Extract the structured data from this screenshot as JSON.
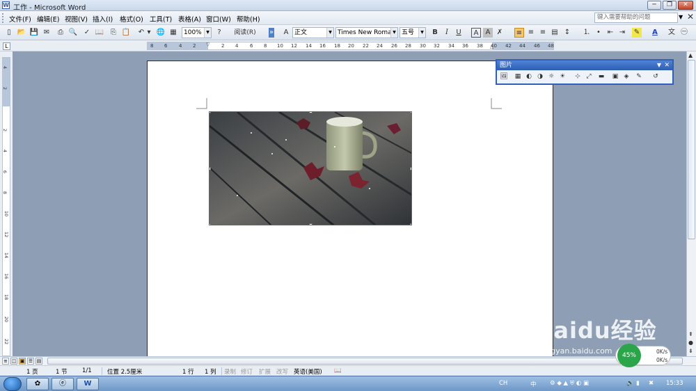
{
  "window": {
    "title": "工作 - Microsoft Word",
    "controls": [
      "─",
      "❐",
      "✕"
    ]
  },
  "menu": {
    "items": [
      "文件(F)",
      "编辑(E)",
      "视图(V)",
      "插入(I)",
      "格式(O)",
      "工具(T)",
      "表格(A)",
      "窗口(W)",
      "帮助(H)"
    ],
    "help_placeholder": "键入需要帮助的问题"
  },
  "toolbar": {
    "zoom": "100%",
    "read_button": "阅读(R)",
    "style": "正文",
    "font": "Times New Roman",
    "font_size": "五号",
    "bold": "B",
    "italic": "I",
    "underline": "U",
    "char_border": "A",
    "char_shading": "A",
    "font_color": "A"
  },
  "ruler": {
    "tab_selector": "L",
    "h_labels": [
      "8",
      "6",
      "4",
      "2",
      "2",
      "4",
      "6",
      "8",
      "10",
      "12",
      "14",
      "16",
      "18",
      "20",
      "22",
      "24",
      "26",
      "28",
      "30",
      "32",
      "34",
      "36",
      "38",
      "40",
      "42",
      "44",
      "46",
      "48"
    ],
    "v_labels": [
      "4",
      "2",
      "2",
      "4",
      "6",
      "8",
      "10",
      "12",
      "14",
      "16",
      "18",
      "20",
      "22"
    ]
  },
  "picture_toolbar": {
    "title": "图片",
    "tools": [
      "🖼",
      "▦",
      "◐",
      "◑",
      "☼",
      "☀",
      "⊹",
      "⤢",
      "▬",
      "▣",
      "◈",
      "✎",
      "↺"
    ]
  },
  "status": {
    "page": "1 页",
    "section": "1 节",
    "page_of": "1/1",
    "position": "位置 2.5厘米",
    "line": "1 行",
    "column": "1 列",
    "rec": "录制",
    "track": "修订",
    "ext": "扩展",
    "ovr": "改写",
    "language": "英语(美国)"
  },
  "taskbar": {
    "clock": "15:33",
    "ime": "CH",
    "ime_mode": "中"
  },
  "net_meter": {
    "percent": "45%",
    "up": "0K/s",
    "down": "0K/s"
  },
  "watermark": {
    "logo": "Baidu经验",
    "url": "jingyan.baidu.com"
  },
  "colors": {
    "workspace": "#8d9eb5",
    "toolbar": "#dde5ef",
    "picture_toolbar_caption": "#2c5db3",
    "taskbar": "#6e98c8"
  }
}
